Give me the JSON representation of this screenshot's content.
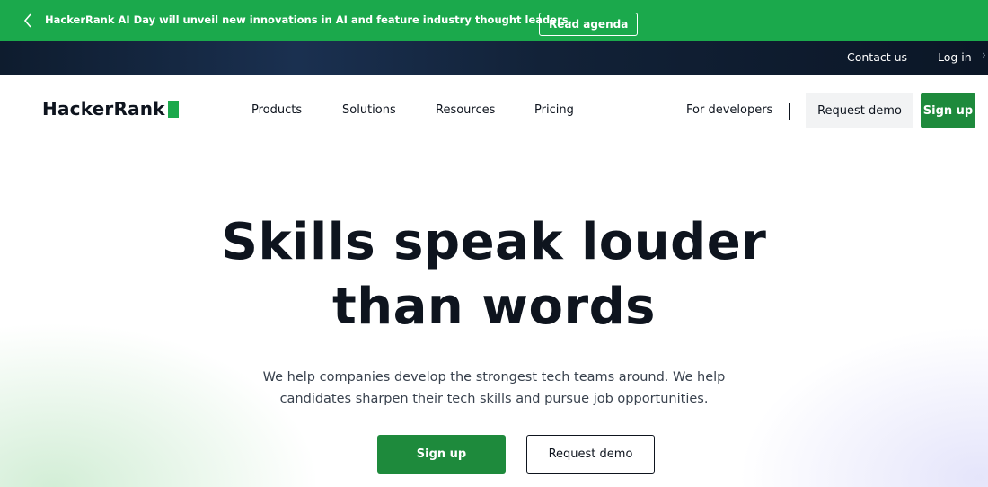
{
  "announcement": {
    "back_icon": "chevron-left-icon",
    "message": "HackerRank AI Day will unveil new innovations in AI and feature industry thought leaders.",
    "cta": "Read agenda"
  },
  "utility_nav": {
    "contact": "Contact us",
    "login": "Log in",
    "more_icon": "chevron-right-icon"
  },
  "header": {
    "logo": "HackerRank",
    "nav_items": [
      "Products",
      "Solutions",
      "Resources",
      "Pricing"
    ],
    "for_developers": "For developers",
    "request_demo": "Request demo",
    "sign_up": "Sign up"
  },
  "hero": {
    "headline_line1": "Skills speak louder",
    "headline_line2": "than words",
    "subtext_line1": "We help companies develop the strongest tech teams around. We help",
    "subtext_line2": "candidates sharpen their tech skills and pursue job opportunities.",
    "primary_cta": "Sign up",
    "secondary_cta": "Request demo"
  },
  "colors": {
    "brand_green": "#1ba94c",
    "button_green": "#1e8a3c",
    "dark_text": "#0e141e",
    "utility_bar": "#0e1c2e"
  }
}
